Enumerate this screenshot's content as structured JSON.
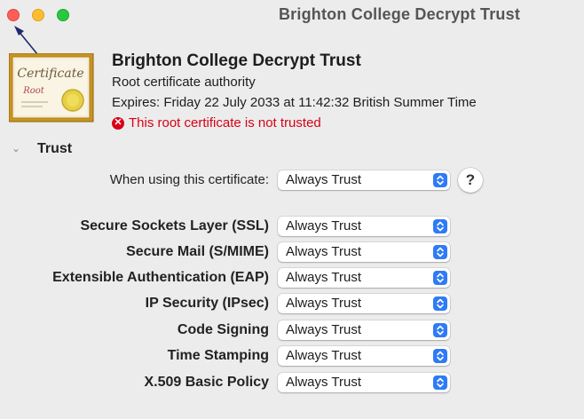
{
  "window": {
    "title": "Brighton College Decrypt Trust"
  },
  "certificate": {
    "icon_text_1": "Certificate",
    "icon_text_2": "Root",
    "name": "Brighton College Decrypt Trust",
    "kind": "Root certificate authority",
    "expires": "Expires: Friday 22 July 2033 at 11:42:32 British Summer Time",
    "warning": "This root certificate is not trusted"
  },
  "trust": {
    "section_label": "Trust",
    "when_using": {
      "label": "When using this certificate:",
      "value": "Always Trust"
    },
    "help_label": "?",
    "policies": [
      {
        "label": "Secure Sockets Layer (SSL)",
        "value": "Always Trust"
      },
      {
        "label": "Secure Mail (S/MIME)",
        "value": "Always Trust"
      },
      {
        "label": "Extensible Authentication (EAP)",
        "value": "Always Trust"
      },
      {
        "label": "IP Security (IPsec)",
        "value": "Always Trust"
      },
      {
        "label": "Code Signing",
        "value": "Always Trust"
      },
      {
        "label": "Time Stamping",
        "value": "Always Trust"
      },
      {
        "label": "X.509 Basic Policy",
        "value": "Always Trust"
      }
    ]
  },
  "colors": {
    "accent": "#2f7bf5",
    "warning": "#d70015",
    "background": "#ececec"
  }
}
